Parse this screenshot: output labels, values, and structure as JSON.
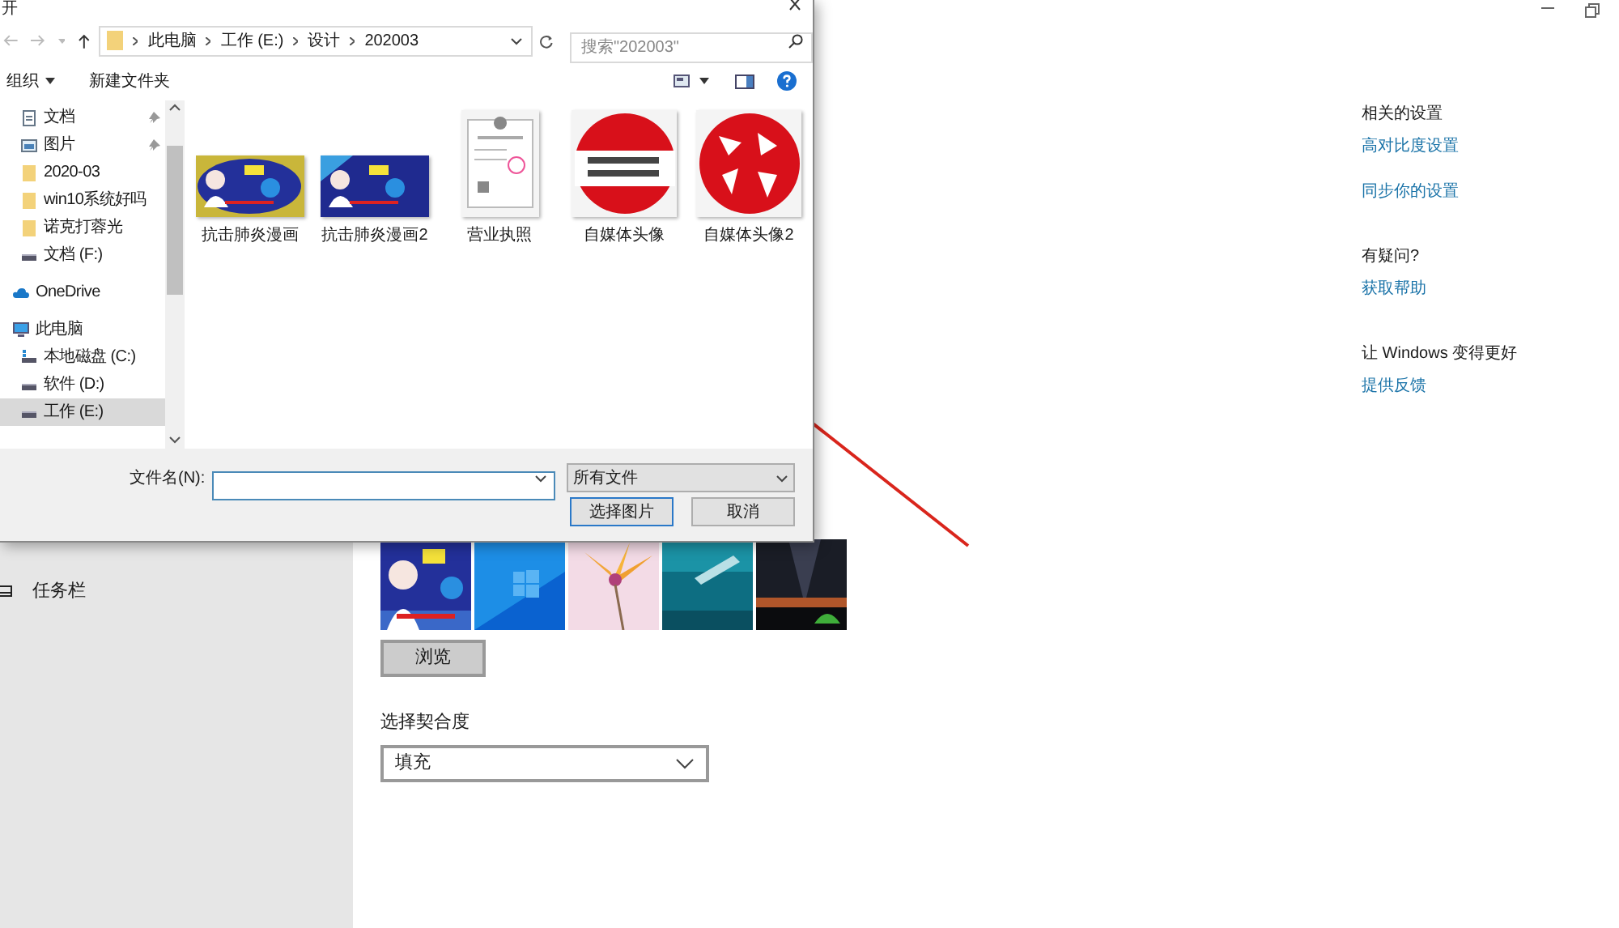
{
  "settings": {
    "sidebar_items": [
      {
        "label": "任务栏"
      }
    ],
    "browse_button": "浏览",
    "fit_label": "选择契合度",
    "fit_value": "填充",
    "sections": [
      {
        "heading": "相关的设置",
        "links": [
          "高对比度设置",
          "同步你的设置"
        ]
      },
      {
        "heading": "有疑问?",
        "links": [
          "获取帮助"
        ]
      },
      {
        "heading": "让 Windows 变得更好",
        "links": [
          "提供反馈"
        ]
      }
    ]
  },
  "dialog": {
    "title": "开",
    "breadcrumbs": [
      "此电脑",
      "工作 (E:)",
      "设计",
      "202003"
    ],
    "search": {
      "placeholder": "搜索\"202003\""
    },
    "toolbar": {
      "organize": "组织",
      "new_folder": "新建文件夹"
    },
    "quick_access": [
      {
        "label": "文档",
        "kind": "document",
        "pinned": true,
        "selected": false
      },
      {
        "label": "图片",
        "kind": "pictures",
        "pinned": true,
        "selected": false
      },
      {
        "label": "2020-03",
        "kind": "folder",
        "pinned": false,
        "selected": false
      },
      {
        "label": "win10系统好吗",
        "kind": "folder",
        "pinned": false,
        "selected": false
      },
      {
        "label": "诺克打蓉光",
        "kind": "folder",
        "pinned": false,
        "selected": false
      },
      {
        "label": "文档 (F:)",
        "kind": "drive",
        "pinned": false,
        "selected": false
      }
    ],
    "tree": [
      {
        "label": "OneDrive",
        "kind": "cloud",
        "selected": false
      },
      {
        "label": "此电脑",
        "kind": "pc",
        "selected": false,
        "children": [
          {
            "label": "本地磁盘 (C:)",
            "kind": "system-drive",
            "selected": false
          },
          {
            "label": "软件 (D:)",
            "kind": "drive",
            "selected": false
          },
          {
            "label": "工作 (E:)",
            "kind": "drive",
            "selected": true
          }
        ]
      }
    ],
    "files": [
      {
        "name": "抗击肺炎漫画",
        "kind": "picture"
      },
      {
        "name": "抗击肺炎漫画2",
        "kind": "picture"
      },
      {
        "name": "营业执照",
        "kind": "picture"
      },
      {
        "name": "自媒体头像",
        "kind": "picture"
      },
      {
        "name": "自媒体头像2",
        "kind": "picture"
      }
    ],
    "filename_label": "文件名(N):",
    "filter": "所有文件",
    "buttons": [
      {
        "label": "选择图片",
        "default": true
      },
      {
        "label": "取消",
        "default": false
      }
    ]
  }
}
